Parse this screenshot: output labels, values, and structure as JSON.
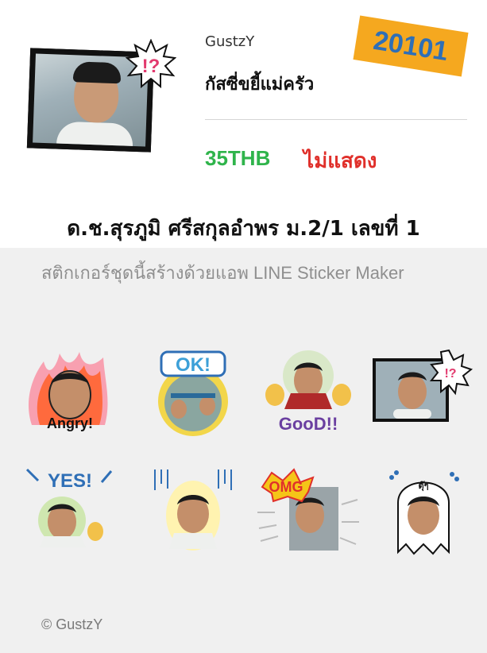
{
  "header": {
    "creator": "GustzY",
    "title": "กัสซี่ขยี้แม่ครัว",
    "price": "35THB",
    "status": "ไม่แสดง",
    "badge": "20101",
    "main_sticker_burst": "!?"
  },
  "class_banner": "ด.ช.สุรภูมิ ศรีสกุลอำพร ม.2/1 เลขที่ 1",
  "description": "สติกเกอร์ชุดนี้สร้างด้วยแอพ LINE Sticker Maker",
  "stickers": [
    {
      "caption": "Angry!",
      "icon": "angry-fire-sticker"
    },
    {
      "caption": "OK!",
      "icon": "ok-sticker"
    },
    {
      "caption": "GooD!!",
      "icon": "good-thumbs-sticker"
    },
    {
      "caption": "!?",
      "icon": "surprise-frame-sticker"
    },
    {
      "caption": "YES!",
      "icon": "yes-sticker"
    },
    {
      "caption": "",
      "icon": "shocked-lines-sticker"
    },
    {
      "caption": "OMG",
      "icon": "omg-sticker"
    },
    {
      "caption": "ตุ๊ๆ",
      "icon": "ghost-sticker"
    }
  ],
  "footer": "© GustzY",
  "colors": {
    "price": "#2fb44b",
    "status": "#e0302b",
    "badge_bg": "#f5a81f",
    "badge_text": "#2f6fb6"
  }
}
